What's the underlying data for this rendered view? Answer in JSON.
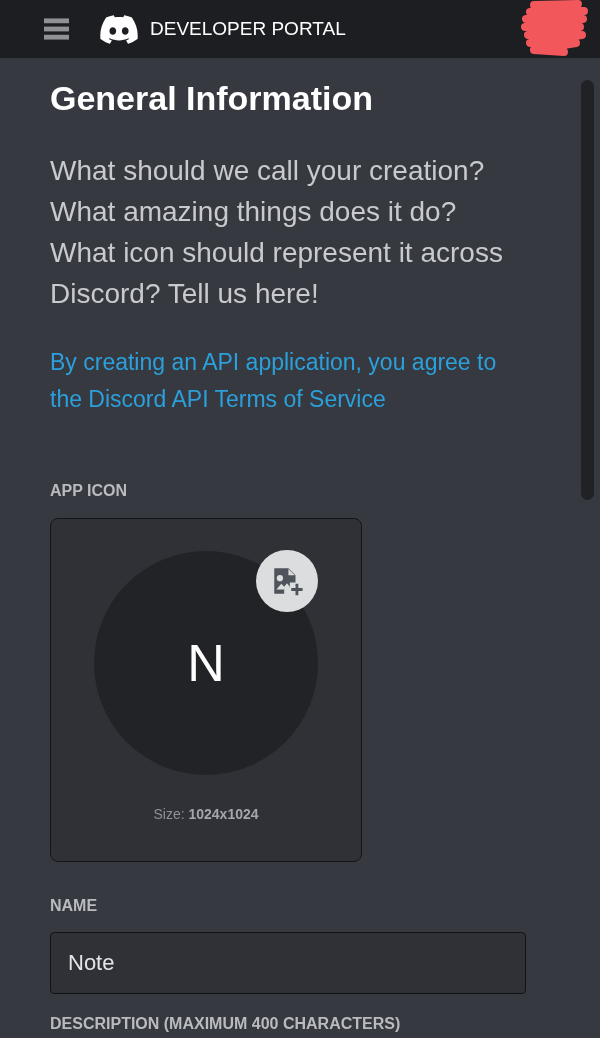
{
  "header": {
    "title": "DEVELOPER PORTAL"
  },
  "page": {
    "title": "General Information",
    "intro": "What should we call your creation? What amazing things does it do? What icon should represent it across Discord? Tell us here!",
    "terms": {
      "text": "By creating an API application, you agree to",
      "link": "the Discord API Terms of Service"
    }
  },
  "app_icon": {
    "label": "APP ICON",
    "initial": "N",
    "size_note": "Size: **1024x1024**"
  },
  "name_field": {
    "label": "NAME",
    "value": "Note"
  },
  "description_field": {
    "label": "DESCRIPTION (MAXIMUM 400 CHARACTERS)"
  }
}
